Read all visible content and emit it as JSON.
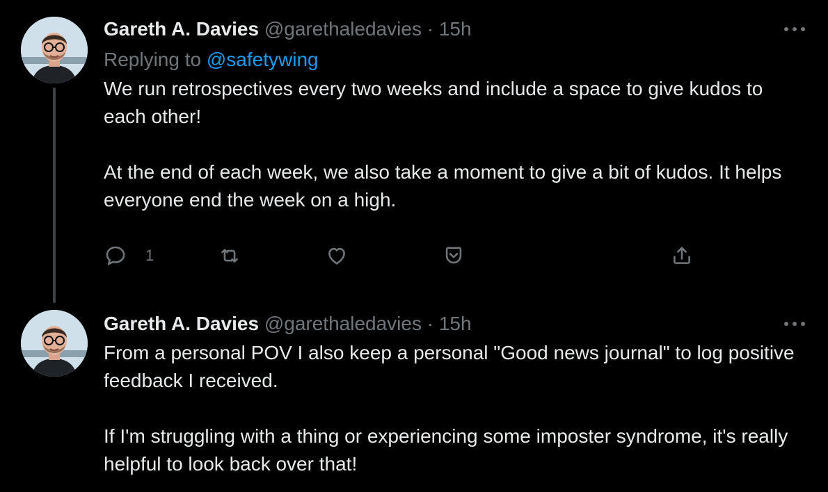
{
  "tweets": [
    {
      "author": {
        "display_name": "Gareth A. Davies",
        "handle": "@garethaledavies",
        "avatar_icon": "avatar-photo"
      },
      "separator": "·",
      "time": "15h",
      "replying_to_prefix": "Replying to",
      "replying_to_handle": "@safetywing",
      "paragraphs": [
        "We run retrospectives every two weeks and include a space to give kudos to each other!",
        "At the end of each week, we also take a moment to give a bit of kudos. It helps everyone end the week on a high."
      ],
      "actions": {
        "reply_count": "1",
        "icons": [
          "reply-icon",
          "retweet-icon",
          "heart-icon",
          "bookmark-save-icon",
          "share-icon"
        ]
      }
    },
    {
      "author": {
        "display_name": "Gareth A. Davies",
        "handle": "@garethaledavies",
        "avatar_icon": "avatar-photo"
      },
      "separator": "·",
      "time": "15h",
      "paragraphs": [
        "From a personal POV I also keep a personal \"Good news journal\" to log positive feedback I received.",
        "If I'm struggling with a thing or experiencing some imposter syndrome, it's really helpful to look back over that!"
      ]
    }
  ],
  "colors": {
    "background": "#000000",
    "text_primary": "#e7e9ea",
    "text_secondary": "#71767b",
    "link": "#1d9bf0",
    "thread_line": "#3e4144"
  }
}
